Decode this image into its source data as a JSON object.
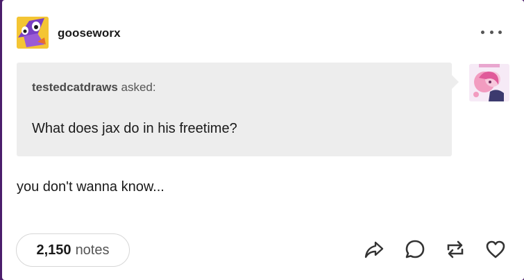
{
  "post": {
    "blog_name": "gooseworx",
    "ask": {
      "asker": "testedcatdraws",
      "asked_label": "asked:",
      "question": "What does jax do in his freetime?"
    },
    "answer": "you don't wanna know...",
    "notes": {
      "count": "2,150",
      "label": "notes"
    }
  },
  "icons": {
    "more": "more-options-icon",
    "share": "share-icon",
    "reply": "reply-icon",
    "reblog": "reblog-icon",
    "like": "heart-icon"
  },
  "colors": {
    "background": "#4b1d6b",
    "card": "#ffffff",
    "ask_box": "#ededed",
    "text": "#1a1a1a",
    "muted": "#555555"
  }
}
